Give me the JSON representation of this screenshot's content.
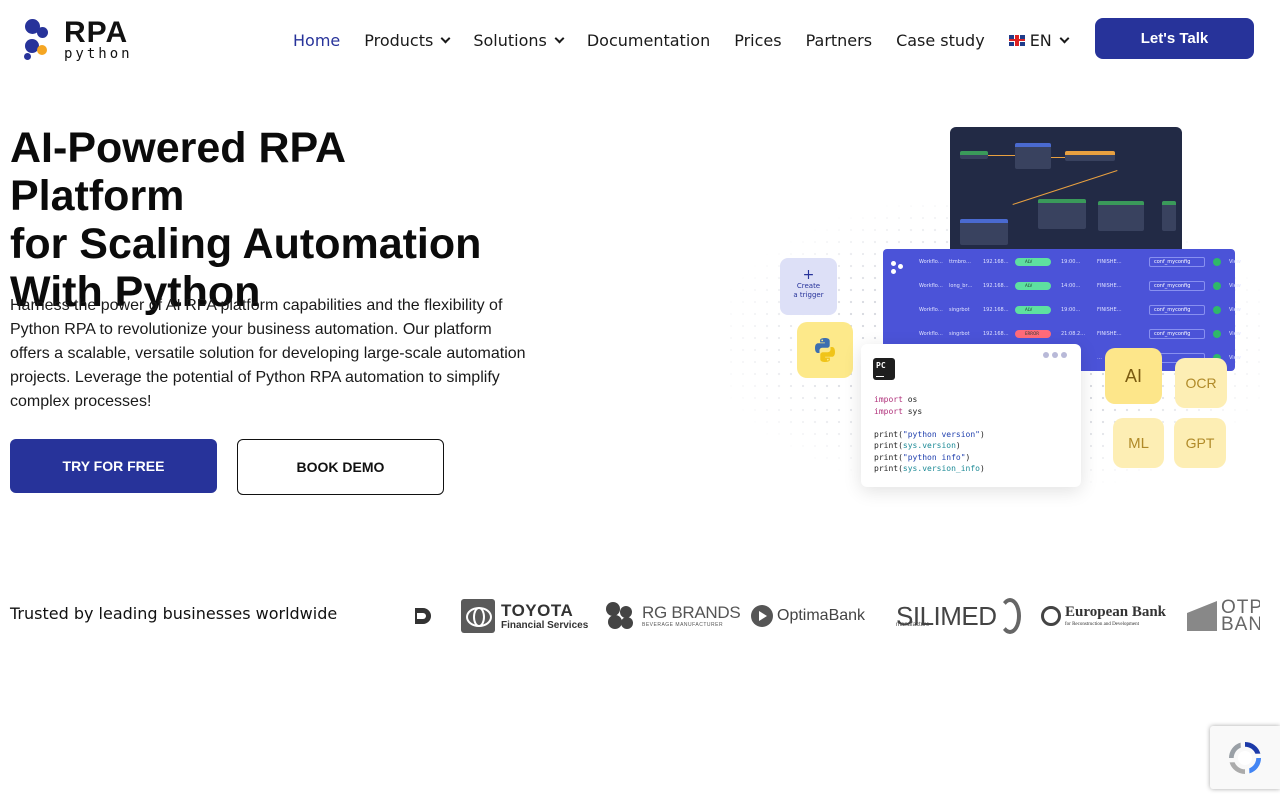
{
  "brand": {
    "logo_big": "RPA",
    "logo_small": "python"
  },
  "nav": {
    "items": [
      {
        "label": "Home",
        "active": true,
        "has_dropdown": false
      },
      {
        "label": "Products",
        "active": false,
        "has_dropdown": true
      },
      {
        "label": "Solutions",
        "active": false,
        "has_dropdown": true
      },
      {
        "label": "Documentation",
        "active": false,
        "has_dropdown": false
      },
      {
        "label": "Prices",
        "active": false,
        "has_dropdown": false
      },
      {
        "label": "Partners",
        "active": false,
        "has_dropdown": false
      },
      {
        "label": "Case study",
        "active": false,
        "has_dropdown": false
      }
    ],
    "language": {
      "code": "EN",
      "icon": "uk-flag-icon"
    },
    "cta_label": "Let's Talk"
  },
  "hero": {
    "title_lines": [
      "AI-Powered RPA Platform",
      "for Scaling Automation",
      "With Python"
    ],
    "description": "Harness the power of AI RPA platform capabilities and the flexibility of Python RPA to revolutionize your business automation. Our platform offers a scalable, versatile solution for developing large-scale automation projects. Leverage the potential of Python RPA automation to simplify complex processes!",
    "primary_cta": "TRY FOR FREE",
    "secondary_cta": "BOOK DEMO"
  },
  "illustration": {
    "trigger_plus": "+",
    "trigger_label_1": "Create",
    "trigger_label_2": "a trigger",
    "rows": [
      {
        "c1": "Workflo…",
        "c2": "ttmbro…",
        "ip": "192.168…",
        "status": "ALV",
        "time": "19:00…",
        "stage": "FINISHE…",
        "config": "conf_myconfig",
        "view": "View",
        "status_color": "#5ee0a0"
      },
      {
        "c1": "Workflo…",
        "c2": "long_br…",
        "ip": "192.168…",
        "status": "ALV",
        "time": "14:00…",
        "stage": "FINISHE…",
        "config": "conf_myconfig",
        "view": "View",
        "status_color": "#5ee0a0"
      },
      {
        "c1": "Workflo…",
        "c2": "singrbot",
        "ip": "192.168…",
        "status": "ALV",
        "time": "19:00…",
        "stage": "FINISHE…",
        "config": "conf_myconfig",
        "view": "View",
        "status_color": "#5ee0a0"
      },
      {
        "c1": "Workflo…",
        "c2": "singrbot",
        "ip": "192.168…",
        "status": "ERROR",
        "time": "21:08.2…",
        "stage": "FINISHE…",
        "config": "conf_myconfig",
        "view": "View",
        "status_color": "#ff6b7a"
      },
      {
        "c1": "Workflo…",
        "c2": "…",
        "ip": "…",
        "status": "ALV",
        "time": "…",
        "stage": "…",
        "config": "…",
        "view": "View",
        "status_color": "#5ee0a0"
      }
    ],
    "code_lines": [
      {
        "kw": "import",
        "rest": " os"
      },
      {
        "kw": "import",
        "rest": " sys"
      },
      {
        "kw": "",
        "rest": ""
      },
      {
        "fn": "print",
        "arg": "\"python version\"",
        "tail": ")"
      },
      {
        "fn": "print",
        "arg": "sys.version",
        "tail": ")"
      },
      {
        "fn": "print",
        "arg": "\"python info\"",
        "tail": ")"
      },
      {
        "fn": "print",
        "arg": "sys.version_info",
        "tail": ")"
      }
    ],
    "ide_badge": "PC",
    "tiles": {
      "ai": "AI",
      "ocr": "OCR",
      "ml": "ML",
      "gpt": "GPT"
    }
  },
  "trusted": {
    "label": "Trusted by leading businesses worldwide",
    "logos": {
      "toyota_name": "TOYOTA",
      "toyota_sub": "Financial Services",
      "rg_name": "RG BRANDS",
      "rg_sub": "BEVERAGE MANUFACTURER",
      "optima": "OptimaBank",
      "silimed_name": "SILIMED",
      "silimed_sub": "manufacture",
      "ebrd_name": "European Bank",
      "ebrd_sub": "for Reconstruction and Development",
      "otp_1": "OTP",
      "otp_2": "BANK"
    }
  },
  "colors": {
    "brand_blue": "#27339a",
    "brand_orange": "#f5a623",
    "tile_yellow": "#fde68a"
  }
}
